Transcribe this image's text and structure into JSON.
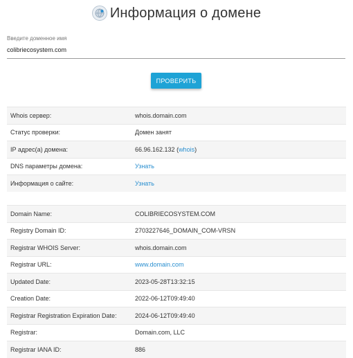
{
  "header": {
    "title": "Информация о домене"
  },
  "search": {
    "label": "Введите доменное имя",
    "value": "colibriecosystem.com"
  },
  "check_button": "ПРОВЕРИТЬ",
  "summary": [
    {
      "label": "Whois сервер:",
      "value": "whois.domain.com"
    },
    {
      "label": "Статус проверки:",
      "value": "Домен занят"
    },
    {
      "label": "IP адрес(а) домена:",
      "value": "66.96.162.132",
      "link_open": " (",
      "link": "whois",
      "link_close": ")"
    },
    {
      "label": "DNS параметры домена:",
      "link": "Узнать"
    },
    {
      "label": "Информация о сайте:",
      "link": "Узнать"
    }
  ],
  "whois": [
    {
      "label": "Domain Name:",
      "value": "COLIBRIECOSYSTEM.COM"
    },
    {
      "label": "Registry Domain ID:",
      "value": "2703227646_DOMAIN_COM-VRSN"
    },
    {
      "label": "Registrar WHOIS Server:",
      "value": "whois.domain.com"
    },
    {
      "label": "Registrar URL:",
      "link": "www.domain.com"
    },
    {
      "label": "Updated Date:",
      "value": "2023-05-28T13:32:15"
    },
    {
      "label": "Creation Date:",
      "value": "2022-06-12T09:49:40"
    },
    {
      "label": "Registrar Registration Expiration Date:",
      "value": "2024-06-12T09:49:40"
    },
    {
      "label": "Registrar:",
      "value": "Domain.com, LLC"
    },
    {
      "label": "Registrar IANA ID:",
      "value": "886"
    }
  ],
  "colors": {
    "accent": "#1ea3d6",
    "link": "#2a8fd0"
  }
}
